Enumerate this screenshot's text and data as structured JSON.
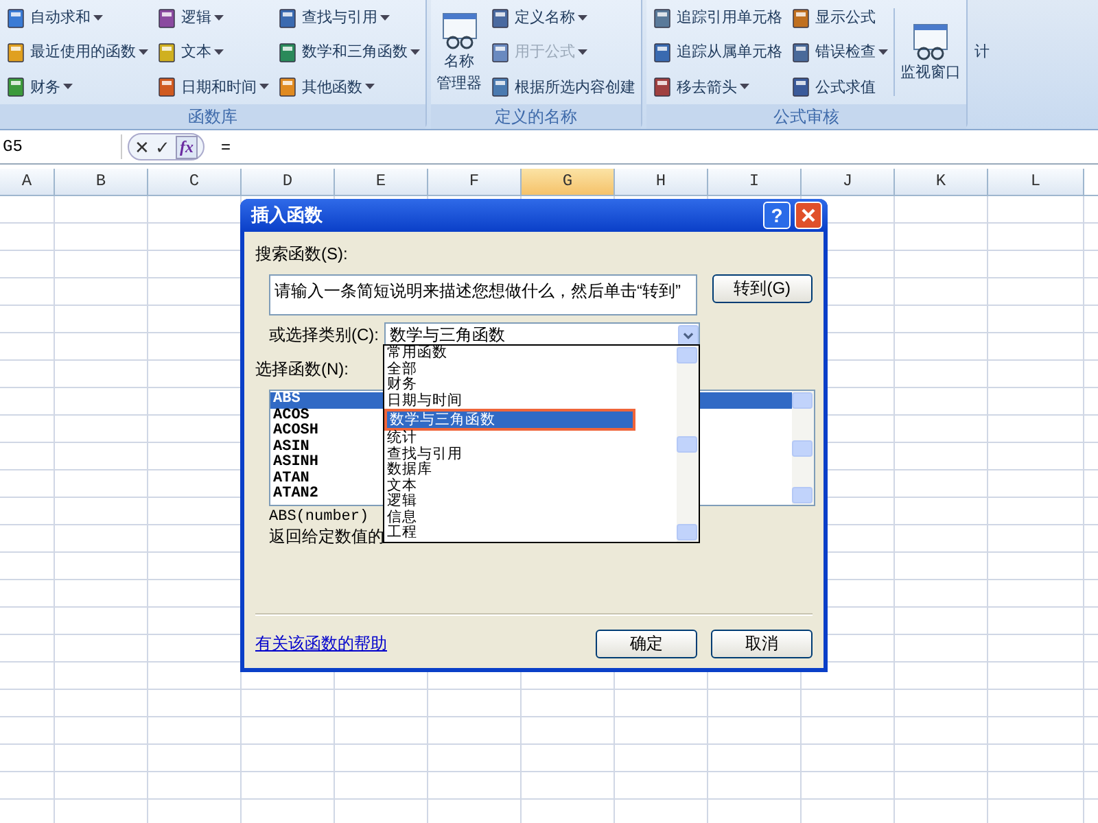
{
  "ribbon": {
    "groups": [
      {
        "label": "函数库",
        "columns": [
          [
            {
              "label": "自动求和",
              "dropdown": true,
              "disabled": false
            },
            {
              "label": "最近使用的函数",
              "dropdown": true,
              "disabled": false
            },
            {
              "label": "财务",
              "dropdown": true,
              "disabled": false
            }
          ],
          [
            {
              "label": "逻辑",
              "dropdown": true,
              "disabled": false
            },
            {
              "label": "文本",
              "dropdown": true,
              "disabled": false
            },
            {
              "label": "日期和时间",
              "dropdown": true,
              "disabled": false
            }
          ],
          [
            {
              "label": "查找与引用",
              "dropdown": true,
              "disabled": false
            },
            {
              "label": "数学和三角函数",
              "dropdown": true,
              "disabled": false
            },
            {
              "label": "其他函数",
              "dropdown": true,
              "disabled": false
            }
          ]
        ]
      },
      {
        "label": "定义的名称",
        "large": {
          "label_lines": [
            "名称",
            "管理器"
          ]
        },
        "columns": [
          [
            {
              "label": "定义名称",
              "dropdown": true,
              "disabled": false
            },
            {
              "label": "用于公式",
              "dropdown": true,
              "disabled": true
            },
            {
              "label": "根据所选内容创建",
              "dropdown": false,
              "disabled": false
            }
          ]
        ]
      },
      {
        "label": "公式审核",
        "columns": [
          [
            {
              "label": "追踪引用单元格",
              "dropdown": false,
              "disabled": false
            },
            {
              "label": "追踪从属单元格",
              "dropdown": false,
              "disabled": false
            },
            {
              "label": "移去箭头",
              "dropdown": true,
              "disabled": false
            }
          ],
          [
            {
              "label": "显示公式",
              "dropdown": false,
              "disabled": false
            },
            {
              "label": "错误检查",
              "dropdown": true,
              "disabled": false
            },
            {
              "label": "公式求值",
              "dropdown": false,
              "disabled": false
            }
          ]
        ],
        "large_after": {
          "label_lines": [
            "监视窗口"
          ]
        }
      }
    ],
    "cut_label": "计"
  },
  "formula_bar": {
    "name_box": "G5",
    "cancel": "✕",
    "enter": "✓",
    "fx": "fx",
    "formula": "="
  },
  "columns": [
    {
      "label": "A",
      "selected": false
    },
    {
      "label": "B",
      "selected": false
    },
    {
      "label": "C",
      "selected": false
    },
    {
      "label": "D",
      "selected": false
    },
    {
      "label": "E",
      "selected": false
    },
    {
      "label": "F",
      "selected": false
    },
    {
      "label": "G",
      "selected": true
    },
    {
      "label": "H",
      "selected": false
    },
    {
      "label": "I",
      "selected": false
    },
    {
      "label": "J",
      "selected": false
    },
    {
      "label": "K",
      "selected": false
    },
    {
      "label": "L",
      "selected": false
    }
  ],
  "dialog": {
    "title": "插入函数",
    "help": "?",
    "search_label": "搜索函数(S):",
    "search_value": "请输入一条简短说明来描述您想做什么，然后单击“转到”",
    "go_button": "转到(G)",
    "category_label": "或选择类别(C):",
    "category_value": "数学与三角函数",
    "category_options": [
      {
        "label": "常用函数",
        "selected": false
      },
      {
        "label": "全部",
        "selected": false
      },
      {
        "label": "财务",
        "selected": false
      },
      {
        "label": "日期与时间",
        "selected": false
      },
      {
        "label": "数学与三角函数",
        "selected": true
      },
      {
        "label": "统计",
        "selected": false
      },
      {
        "label": "查找与引用",
        "selected": false
      },
      {
        "label": "数据库",
        "selected": false
      },
      {
        "label": "文本",
        "selected": false
      },
      {
        "label": "逻辑",
        "selected": false
      },
      {
        "label": "信息",
        "selected": false
      },
      {
        "label": "工程",
        "selected": false
      }
    ],
    "function_label": "选择函数(N):",
    "functions": [
      {
        "label": "ABS",
        "selected": true
      },
      {
        "label": "ACOS",
        "selected": false
      },
      {
        "label": "ACOSH",
        "selected": false
      },
      {
        "label": "ASIN",
        "selected": false
      },
      {
        "label": "ASINH",
        "selected": false
      },
      {
        "label": "ATAN",
        "selected": false
      },
      {
        "label": "ATAN2",
        "selected": false
      }
    ],
    "syntax": "ABS(number)",
    "description": "返回给定数值的",
    "help_link": "有关该函数的帮助",
    "ok": "确定",
    "cancel": "取消"
  }
}
